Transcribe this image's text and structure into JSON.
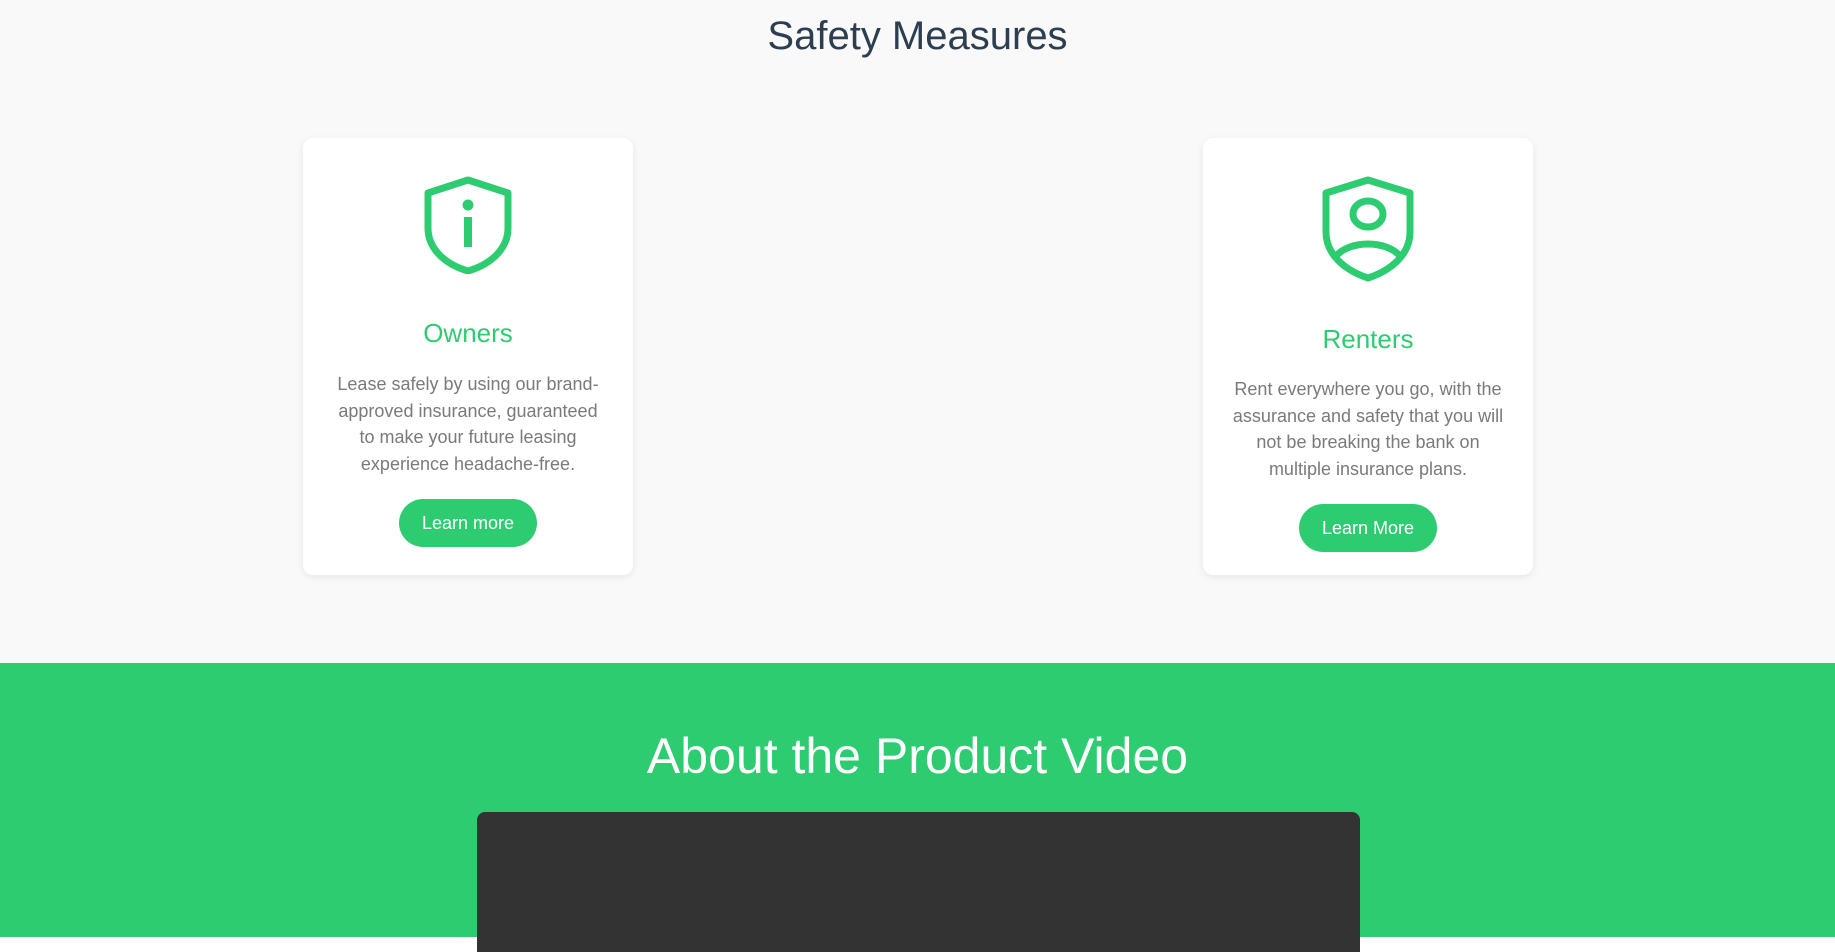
{
  "safety": {
    "title": "Safety Measures",
    "cards": [
      {
        "icon": "shield-info-icon",
        "heading": "Owners",
        "text": "Lease safely by using our brand-approved insurance, guaranteed to make your future leasing experience headache-free.",
        "button": "Learn more"
      },
      {
        "icon": "shield-user-icon",
        "heading": "Renters",
        "text": "Rent everywhere you go, with the assurance and safety that you will not be breaking the bank on multiple insurance plans.",
        "button": "Learn More"
      }
    ]
  },
  "video": {
    "title": "About the Product Video"
  },
  "colors": {
    "accent": "#2ecc71",
    "heading": "#2c3e50",
    "body_text": "#7a7a7a",
    "section_bg": "#f9f9f9",
    "video_bg": "#333333"
  }
}
